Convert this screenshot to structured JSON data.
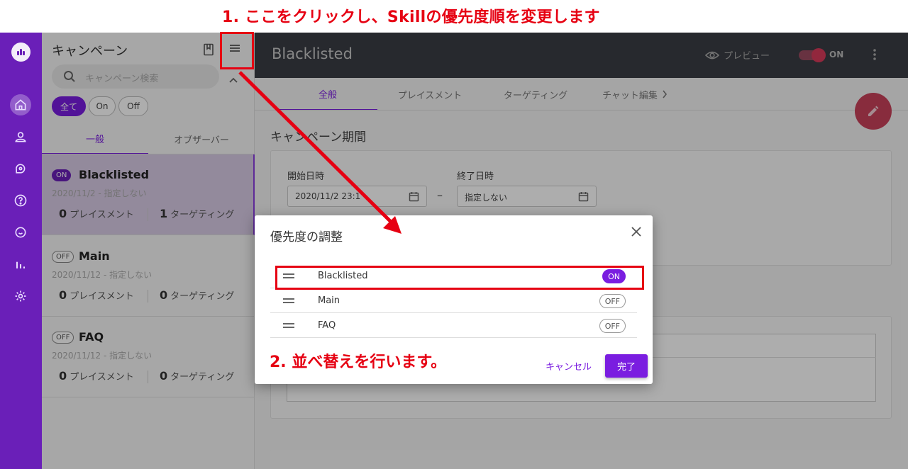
{
  "annotations": {
    "step1": "1. ここをクリックし、Skillの優先度順を変更します",
    "step2": "2. 並べ替えを行います。"
  },
  "sidebar": {
    "title": "キャンペーン",
    "search_placeholder": "キャンペーン検索",
    "filters": [
      "全て",
      "On",
      "Off"
    ],
    "tabs": [
      "一般",
      "オブザーバー"
    ],
    "campaigns": [
      {
        "status": "ON",
        "name": "Blacklisted",
        "date": "2020/11/2 - 指定しない",
        "placements": "0",
        "placements_label": "プレイスメント",
        "targetings": "1",
        "targetings_label": "ターゲティング"
      },
      {
        "status": "OFF",
        "name": "Main",
        "date": "2020/11/12 - 指定しない",
        "placements": "0",
        "placements_label": "プレイスメント",
        "targetings": "0",
        "targetings_label": "ターゲティング"
      },
      {
        "status": "OFF",
        "name": "FAQ",
        "date": "2020/11/12 - 指定しない",
        "placements": "0",
        "placements_label": "プレイスメント",
        "targetings": "0",
        "targetings_label": "ターゲティング"
      }
    ]
  },
  "header": {
    "title": "Blacklisted",
    "preview": "プレビュー",
    "toggle_label": "ON"
  },
  "tabs": [
    "全般",
    "プレイスメント",
    "ターゲティング",
    "チャット編集"
  ],
  "period": {
    "title": "キャンペーン期間",
    "start_label": "開始日時",
    "start_value": "2020/11/2 23:1",
    "end_label": "終了日時",
    "end_value": "指定しない",
    "separator": "–"
  },
  "dialog": {
    "title": "優先度の調整",
    "rows": [
      {
        "name": "Blacklisted",
        "status": "ON"
      },
      {
        "name": "Main",
        "status": "OFF"
      },
      {
        "name": "FAQ",
        "status": "OFF"
      }
    ],
    "cancel": "キャンセル",
    "done": "完了"
  },
  "colors": {
    "brand": "#6a1fb8",
    "accent": "#7a1de0",
    "annotation": "#e60012",
    "fab": "#c9415a"
  },
  "icons": [
    "home-icon",
    "user-icon",
    "campaign-icon",
    "help-icon",
    "chat-icon",
    "analytics-icon",
    "gear-icon",
    "book-icon",
    "menu-icon",
    "search-icon",
    "calendar-icon",
    "eye-icon",
    "kebab-icon",
    "pencil-icon",
    "close-icon",
    "drag-handle-icon"
  ]
}
